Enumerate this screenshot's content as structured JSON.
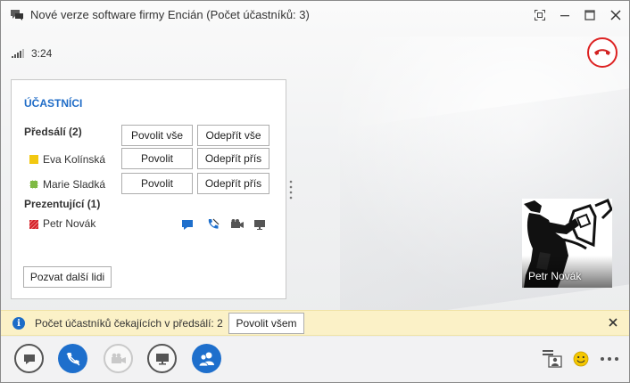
{
  "window": {
    "title": "Nové verze software firmy Encián (Počet účastníků: 3)"
  },
  "call": {
    "timer": "3:24"
  },
  "participants": {
    "heading": "ÚČASTNÍCI",
    "lobby": {
      "label": "Předsálí (2)",
      "allow_all_label": "Povolit vše",
      "deny_all_label": "Odepřít vše",
      "people": [
        {
          "name": "Eva Kolínská",
          "status_color": "#f2c811",
          "allow_label": "Povolit",
          "deny_label": "Odepřít přís"
        },
        {
          "name": "Marie Sladká",
          "status_color": "#7fba44",
          "allow_label": "Povolit",
          "deny_label": "Odepřít přís"
        }
      ]
    },
    "presenters": {
      "label": "Prezentující (1)",
      "people": [
        {
          "name": "Petr Novák",
          "status_color": "#d4232b",
          "icons": [
            "im-icon",
            "audio-muted-icon",
            "video-icon",
            "screen-share-icon"
          ]
        }
      ]
    },
    "invite_label": "Pozvat další lidi"
  },
  "video": {
    "name": "Petr Novák"
  },
  "lobby_notice": {
    "text": "Počet účastníků čekajících v předsálí: 2",
    "button_label": "Povolit všem"
  },
  "toolbar": {
    "buttons": [
      "im-button",
      "mute-button",
      "video-button",
      "present-button",
      "participants-button"
    ],
    "right_icons": [
      "contact-card-icon",
      "emoticon-icon",
      "more-options-icon"
    ]
  },
  "colors": {
    "accent": "#1e6fcc",
    "hangup": "#d22222",
    "notice_bg": "#fbf1c7"
  }
}
